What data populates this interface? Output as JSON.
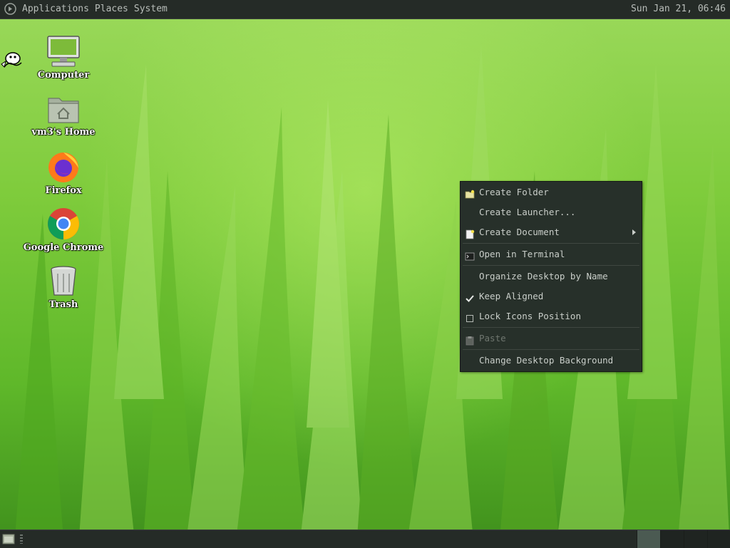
{
  "top_panel": {
    "menus": [
      "Applications",
      "Places",
      "System"
    ],
    "clock": "Sun Jan 21, 06:46",
    "logo_icon": "mate-menu-logo-icon"
  },
  "desktop_icons": [
    {
      "label": "Computer",
      "icon": "computer-icon"
    },
    {
      "label": "vm3's Home",
      "icon": "home-folder-icon"
    },
    {
      "label": "Firefox",
      "icon": "firefox-icon"
    },
    {
      "label": "Google Chrome",
      "icon": "chrome-icon"
    },
    {
      "label": "Trash",
      "icon": "trash-icon"
    }
  ],
  "context_menu": {
    "items": [
      {
        "label": "Create Folder",
        "icon": "new-folder-icon"
      },
      {
        "label": "Create Launcher...",
        "icon": ""
      },
      {
        "label": "Create Document",
        "icon": "new-document-icon",
        "has_submenu": true
      },
      {
        "label": "Open in Terminal",
        "icon": "terminal-icon"
      },
      {
        "label": "Organize Desktop by Name",
        "icon": ""
      },
      {
        "label": "Keep Aligned",
        "icon": "checkmark-icon",
        "checked": true
      },
      {
        "label": "Lock Icons Position",
        "icon": "checkbox-icon",
        "checked": false
      },
      {
        "label": "Paste",
        "icon": "paste-icon",
        "disabled": true
      },
      {
        "label": "Change Desktop Background",
        "icon": ""
      }
    ]
  },
  "colors": {
    "panel_bg": "#252b27",
    "menu_bg": "#27302a",
    "menu_text": "#c9cec9",
    "wallpaper_green": "#6fbf2e"
  }
}
